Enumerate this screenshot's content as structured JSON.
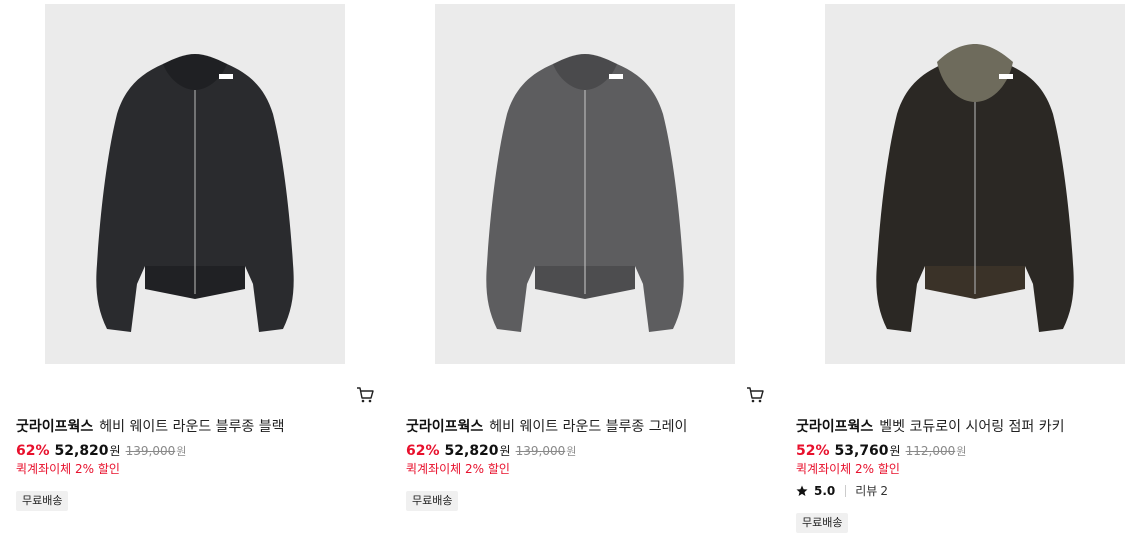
{
  "colors": {
    "accent_red": "#e8112d",
    "thumb_bg": "#ebebeb",
    "badge_bg": "#f0f0f0"
  },
  "products": [
    {
      "brand": "굿라이프웍스",
      "name": "헤비 웨이트 라운드 블루종 블랙",
      "discount": "62%",
      "price": "52,820",
      "currency": "원",
      "original_price": "139,000",
      "promo": "퀵계좌이체 2% 할인",
      "badge": "무료배송",
      "image": {
        "icon": "jacket-black-image",
        "body_color": "#2a2b2e",
        "collar_color": "#2a2b2e"
      }
    },
    {
      "brand": "굿라이프웍스",
      "name": "헤비 웨이트 라운드 블루종 그레이",
      "discount": "62%",
      "price": "52,820",
      "currency": "원",
      "original_price": "139,000",
      "promo": "퀵계좌이체 2% 할인",
      "badge": "무료배송",
      "image": {
        "icon": "jacket-gray-image",
        "body_color": "#5d5d5f",
        "collar_color": "#5d5d5f"
      }
    },
    {
      "brand": "굿라이프웍스",
      "name": "벨벳 코듀로이 시어링 점퍼 카키",
      "discount": "52%",
      "price": "53,760",
      "currency": "원",
      "original_price": "112,000",
      "promo": "퀵계좌이체 2% 할인",
      "rating": "5.0",
      "review_label": "리뷰",
      "review_count": "2",
      "badge": "무료배송",
      "image": {
        "icon": "jacket-khaki-image",
        "body_color": "#2b2824",
        "collar_color": "#6e6b5c"
      }
    }
  ],
  "icons": {
    "cart": "cart-icon",
    "star": "star-icon"
  }
}
